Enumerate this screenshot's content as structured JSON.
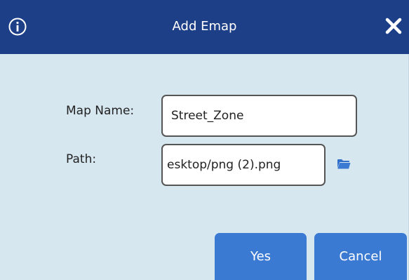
{
  "dialog": {
    "title": "Add Emap",
    "info_icon": "info-circle-icon",
    "close_icon": "close-x-icon"
  },
  "form": {
    "map_name_label": "Map Name:",
    "map_name_value": "Street_Zone",
    "path_label": "Path:",
    "path_value": "esktop/png (2).png",
    "browse_icon": "folder-open-icon"
  },
  "buttons": {
    "yes_label": "Yes",
    "cancel_label": "Cancel"
  },
  "colors": {
    "titlebar": "#1c3f87",
    "background": "#d7e7f0",
    "button": "#3b7ad3",
    "field_border": "#555555"
  }
}
